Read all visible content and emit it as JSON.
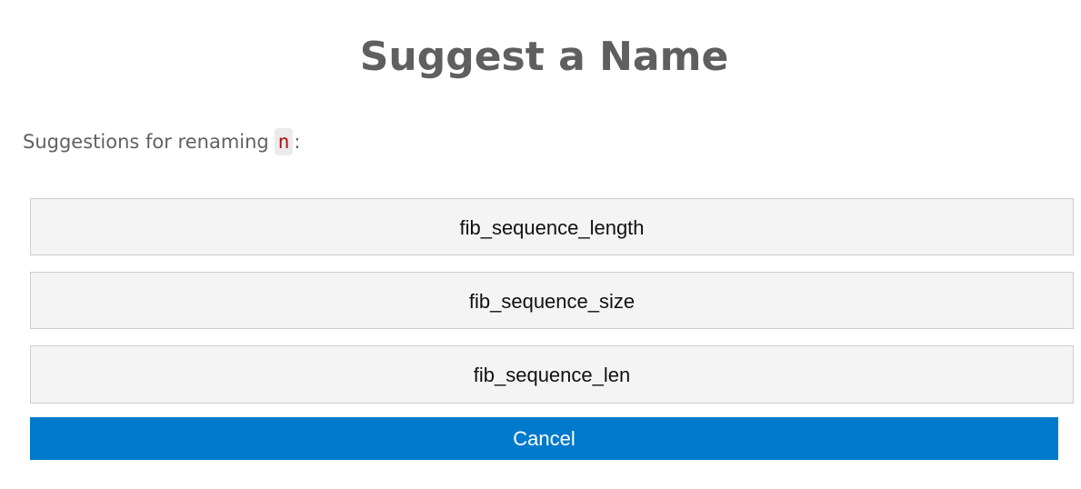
{
  "dialog": {
    "title": "Suggest a Name",
    "prompt_text": "Suggestions for renaming",
    "variable": "n",
    "prompt_suffix": ":"
  },
  "suggestions": [
    {
      "label": "fib_sequence_length"
    },
    {
      "label": "fib_sequence_size"
    },
    {
      "label": "fib_sequence_len"
    }
  ],
  "actions": {
    "cancel_label": "Cancel"
  },
  "colors": {
    "primary_button": "#007acc",
    "suggestion_background": "#f4f4f4",
    "suggestion_border": "#cccccc",
    "variable_text": "#a31515",
    "variable_background": "#ebebeb",
    "title_text": "#5f5f5f"
  }
}
